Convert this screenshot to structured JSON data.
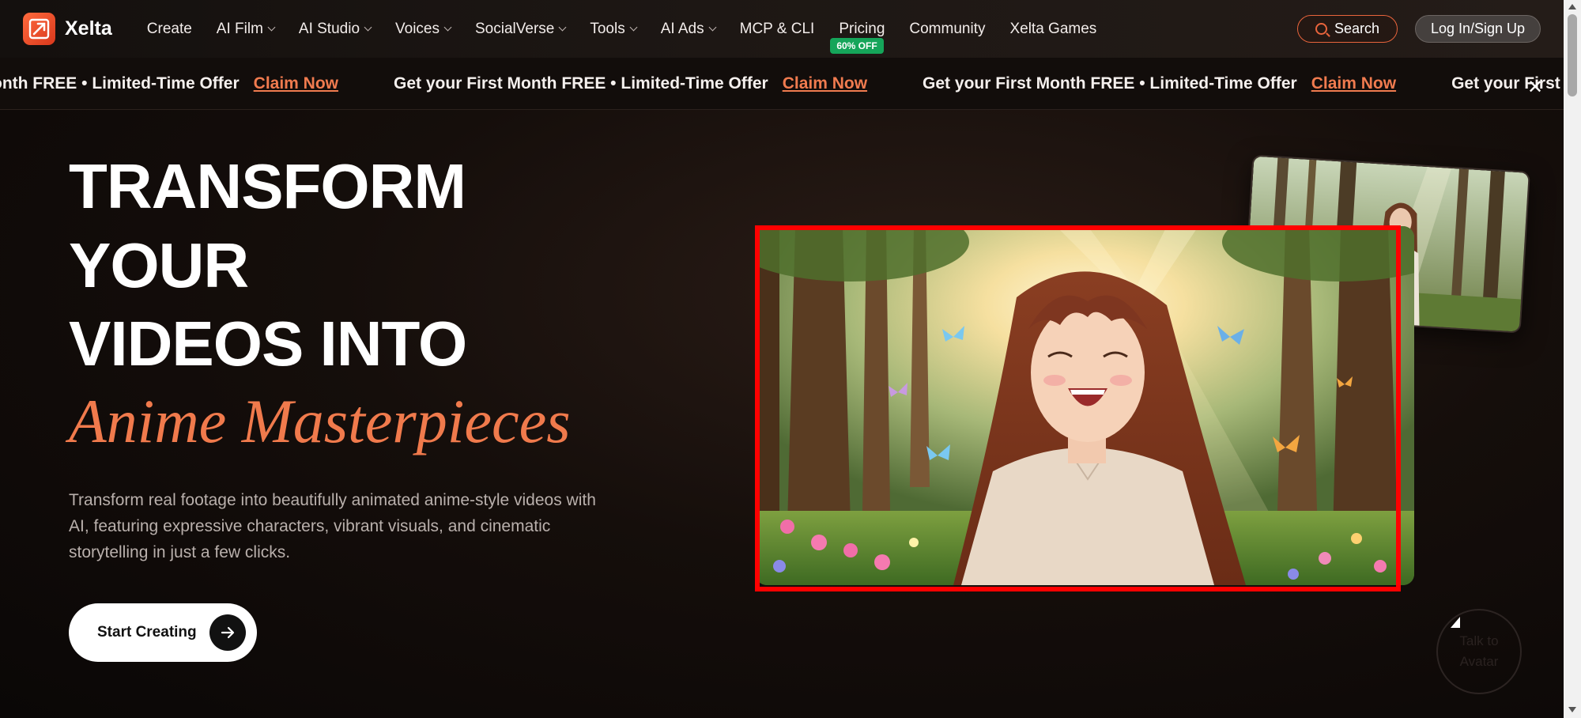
{
  "brand": {
    "name": "Xelta"
  },
  "nav": {
    "items": [
      {
        "label": "Create",
        "dropdown": false
      },
      {
        "label": "AI Film",
        "dropdown": true
      },
      {
        "label": "AI Studio",
        "dropdown": true
      },
      {
        "label": "Voices",
        "dropdown": true
      },
      {
        "label": "SocialVerse",
        "dropdown": true
      },
      {
        "label": "Tools",
        "dropdown": true
      },
      {
        "label": "AI Ads",
        "dropdown": true
      },
      {
        "label": "MCP & CLI",
        "dropdown": false
      },
      {
        "label": "Pricing",
        "dropdown": false,
        "badge": "60% OFF"
      },
      {
        "label": "Community",
        "dropdown": false
      },
      {
        "label": "Xelta Games",
        "dropdown": false
      }
    ],
    "search_label": "Search",
    "login_label": "Log In/Sign Up"
  },
  "promo": {
    "segments": [
      {
        "text": "onth FREE • Limited-Time Offer",
        "link": "Claim Now"
      },
      {
        "text": "Get your First Month FREE • Limited-Time Offer",
        "link": "Claim Now"
      },
      {
        "text": "Get your First Month FREE • Limited-Time Offer",
        "link": "Claim Now"
      },
      {
        "text": "Get your First Mo",
        "link": ""
      }
    ],
    "close": "✕"
  },
  "hero": {
    "line1": "TRANSFORM",
    "line2": "YOUR",
    "line3": "VIDEOS INTO",
    "accent": "Anime Masterpieces",
    "description": "Transform real footage into beautifully animated anime-style videos with AI, featuring expressive characters, vibrant visuals, and cinematic storytelling in just a few clicks.",
    "cta_label": "Start Creating"
  },
  "widget": {
    "line1": "Talk to",
    "line2": "Avatar"
  },
  "colors": {
    "accent": "#f07a4c",
    "badge": "#15a55a",
    "highlight_frame": "#ff0000"
  }
}
